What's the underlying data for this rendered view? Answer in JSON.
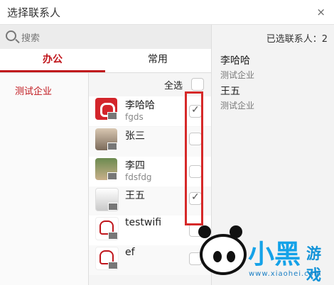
{
  "window": {
    "title": "选择联系人",
    "close": "×"
  },
  "search": {
    "placeholder": "搜索"
  },
  "selected": {
    "count_label": "已选联系人：2"
  },
  "tabs": [
    {
      "label": "办公"
    },
    {
      "label": "常用"
    }
  ],
  "company": {
    "name": "测试企业"
  },
  "select_all": {
    "label": "全选"
  },
  "contacts": [
    {
      "name": "李哈哈",
      "sub": "fgds",
      "checked": true
    },
    {
      "name": "张三",
      "sub": "",
      "checked": false
    },
    {
      "name": "李四",
      "sub": "fdsfdg",
      "checked": false
    },
    {
      "name": "王五",
      "sub": "",
      "checked": true
    },
    {
      "name": "testwifi",
      "sub": "",
      "checked": false
    },
    {
      "name": "ef",
      "sub": "",
      "checked": false
    }
  ],
  "selected_items": [
    {
      "name": "李哈哈",
      "company": "测试企业"
    },
    {
      "name": "王五",
      "company": "测试企业"
    }
  ],
  "watermark": {
    "logo": "小黑",
    "small": "游戏",
    "url": "www.xiaohei.com"
  }
}
